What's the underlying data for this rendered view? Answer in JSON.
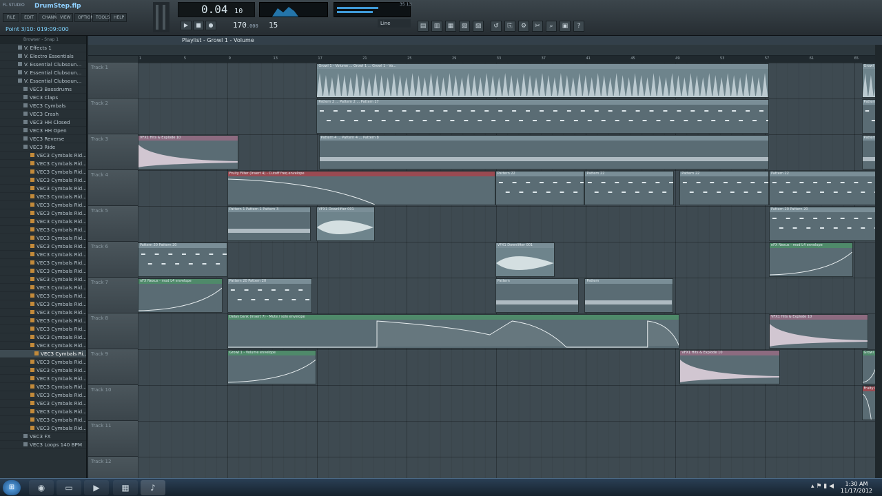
{
  "toolbar": {
    "file": "DrumStep.flp",
    "logo": "FL STUDIO",
    "menu": [
      "FILE",
      "EDIT",
      "CHANNELS",
      "VIEW",
      "OPTIONS",
      "TOOLS",
      "HELP"
    ],
    "hint": "Point 3/10: 019:09:000",
    "time_main": "0.04",
    "time_sub": "10",
    "tempo": "170",
    "tempo_dec": ".000",
    "tempo_label": "TEMPO",
    "pattern": "15",
    "snap": "Line",
    "cpu": "35  13"
  },
  "browser": {
    "header": "Browser - Snap 1",
    "items": [
      {
        "t": "V. Effects 1",
        "k": "f"
      },
      {
        "t": "V. Electro Essentials",
        "k": "f"
      },
      {
        "t": "V. Essential Clubsoun...",
        "k": "f"
      },
      {
        "t": "V. Essential Clubsoun...",
        "k": "f"
      },
      {
        "t": "V. Essential Clubsoun...",
        "k": "f"
      },
      {
        "t": "VEC3 Bassdrums",
        "k": "f"
      },
      {
        "t": "VEC3 Claps",
        "k": "f"
      },
      {
        "t": "VEC3 Cymbals",
        "k": "f"
      },
      {
        "t": "VEC3 Crash",
        "k": "f"
      },
      {
        "t": "VEC3 HH Closed",
        "k": "f"
      },
      {
        "t": "VEC3 HH Open",
        "k": "f"
      },
      {
        "t": "VEC3 Reverse",
        "k": "f"
      },
      {
        "t": "VEC3 Ride",
        "k": "f"
      },
      {
        "t": "VEC3 Cymbals Rid...",
        "k": "s"
      },
      {
        "t": "VEC3 Cymbals Rid...",
        "k": "s"
      },
      {
        "t": "VEC3 Cymbals Rid...",
        "k": "s"
      },
      {
        "t": "VEC3 Cymbals Rid...",
        "k": "s"
      },
      {
        "t": "VEC3 Cymbals Rid...",
        "k": "s"
      },
      {
        "t": "VEC3 Cymbals Rid...",
        "k": "s"
      },
      {
        "t": "VEC3 Cymbals Rid...",
        "k": "s"
      },
      {
        "t": "VEC3 Cymbals Rid...",
        "k": "s"
      },
      {
        "t": "VEC3 Cymbals Rid...",
        "k": "s"
      },
      {
        "t": "VEC3 Cymbals Rid...",
        "k": "s"
      },
      {
        "t": "VEC3 Cymbals Rid...",
        "k": "s"
      },
      {
        "t": "VEC3 Cymbals Rid...",
        "k": "s"
      },
      {
        "t": "VEC3 Cymbals Rid...",
        "k": "s"
      },
      {
        "t": "VEC3 Cymbals Rid...",
        "k": "s"
      },
      {
        "t": "VEC3 Cymbals Rid...",
        "k": "s"
      },
      {
        "t": "VEC3 Cymbals Rid...",
        "k": "s"
      },
      {
        "t": "VEC3 Cymbals Rid...",
        "k": "s"
      },
      {
        "t": "VEC3 Cymbals Rid...",
        "k": "s"
      },
      {
        "t": "VEC3 Cymbals Rid...",
        "k": "s"
      },
      {
        "t": "VEC3 Cymbals Rid...",
        "k": "s"
      },
      {
        "t": "VEC3 Cymbals Rid...",
        "k": "s"
      },
      {
        "t": "VEC3 Cymbals Rid...",
        "k": "s"
      },
      {
        "t": "VEC3 Cymbals Rid...",
        "k": "s"
      },
      {
        "t": "VEC3 Cymbals Rid...",
        "k": "s"
      },
      {
        "t": "VEC3 Cymbals Ri...",
        "k": "s",
        "sel": true
      },
      {
        "t": "VEC3 Cymbals Rid...",
        "k": "s"
      },
      {
        "t": "VEC3 Cymbals Rid...",
        "k": "s"
      },
      {
        "t": "VEC3 Cymbals Rid...",
        "k": "s"
      },
      {
        "t": "VEC3 Cymbals Rid...",
        "k": "s"
      },
      {
        "t": "VEC3 Cymbals Rid...",
        "k": "s"
      },
      {
        "t": "VEC3 Cymbals Rid...",
        "k": "s"
      },
      {
        "t": "VEC3 Cymbals Rid...",
        "k": "s"
      },
      {
        "t": "VEC3 Cymbals Rid...",
        "k": "s"
      },
      {
        "t": "VEC3 Cymbals Rid...",
        "k": "s"
      },
      {
        "t": "VEC3 FX",
        "k": "f"
      },
      {
        "t": "VEC3 Loops 140 BPM",
        "k": "f"
      }
    ]
  },
  "playlist": {
    "title": "Playlist - Growl 1 - Volume",
    "tracks": [
      "Track 1",
      "Track 2",
      "Track 3",
      "Track 4",
      "Track 5",
      "Track 6",
      "Track 7",
      "Track 8",
      "Track 9",
      "Track 10",
      "Track 11",
      "Track 12"
    ],
    "bars": [
      "1",
      "5",
      "9",
      "13",
      "17",
      "21",
      "25",
      "29",
      "33",
      "37",
      "41",
      "45",
      "49",
      "53",
      "57",
      "61",
      "65"
    ],
    "clips": [
      {
        "track": 0,
        "start": 16,
        "len": 40.5,
        "label": "Growl 1 - Volume ... Growl 1 ... Growl 1 - Vo...",
        "kind": "audio",
        "wave": "spikes"
      },
      {
        "track": 0,
        "start": 64.8,
        "len": 1.5,
        "label": "Growl 1",
        "kind": "audio",
        "wave": "spikes"
      },
      {
        "track": 1,
        "start": 16,
        "len": 40.5,
        "label": "Pattern 2 ... Pattern 2 ... Pattern 17",
        "kind": "pattern",
        "wave": "notes"
      },
      {
        "track": 1,
        "start": 64.8,
        "len": 1.5,
        "label": "Pattern",
        "kind": "pattern",
        "wave": "notes"
      },
      {
        "track": 2,
        "start": 0,
        "len": 9,
        "label": "VFX1 Hits & Explode 10",
        "kind": "pink",
        "wave": "decay"
      },
      {
        "track": 2,
        "start": 16.2,
        "len": 40.3,
        "label": "Pattern 4 ... Pattern 4 ... Pattern 8",
        "kind": "pattern",
        "wave": "flat"
      },
      {
        "track": 2,
        "start": 64.8,
        "len": 1.5,
        "label": "Pattern",
        "kind": "pattern",
        "wave": "flat"
      },
      {
        "track": 3,
        "start": 8,
        "len": 24,
        "label": "Fruity Filter (Insert 4) - Cutoff freq envelope",
        "kind": "red",
        "wave": "fall"
      },
      {
        "track": 3,
        "start": 32,
        "len": 8,
        "label": "Pattern 22",
        "kind": "pattern",
        "wave": "notes"
      },
      {
        "track": 3,
        "start": 40,
        "len": 8,
        "label": "Pattern 22",
        "kind": "pattern",
        "wave": "notes"
      },
      {
        "track": 3,
        "start": 48.5,
        "len": 8,
        "label": "Pattern 22",
        "kind": "pattern",
        "wave": "notes"
      },
      {
        "track": 3,
        "start": 56.5,
        "len": 9.8,
        "label": "Pattern 22",
        "kind": "pattern",
        "wave": "notes"
      },
      {
        "track": 4,
        "start": 8,
        "len": 7.5,
        "label": "Pattern 1  Pattern 1  Pattern 3",
        "kind": "pattern",
        "wave": "flat"
      },
      {
        "track": 4,
        "start": 16,
        "len": 5.2,
        "label": "VFX1 Downlifter 001",
        "kind": "audio",
        "wave": "swell"
      },
      {
        "track": 4,
        "start": 56.5,
        "len": 9.8,
        "label": "Pattern 20  Pattern 20",
        "kind": "pattern",
        "wave": "notes"
      },
      {
        "track": 5,
        "start": 0,
        "len": 8,
        "label": "Pattern 20  Pattern 20",
        "kind": "pattern",
        "wave": "notes"
      },
      {
        "track": 5,
        "start": 32,
        "len": 5.3,
        "label": "VFX1 Downlifter 001",
        "kind": "audio",
        "wave": "swell"
      },
      {
        "track": 5,
        "start": 56.5,
        "len": 7.5,
        "label": "nFX Nexus - mod L4 envelope",
        "kind": "green",
        "wave": "rise"
      },
      {
        "track": 6,
        "start": 0,
        "len": 7.6,
        "label": "nFX Nexus - mod L4 envelope",
        "kind": "green",
        "wave": "rise"
      },
      {
        "track": 6,
        "start": 8,
        "len": 7.6,
        "label": "Pattern 20  Pattern 20",
        "kind": "pattern",
        "wave": "notes"
      },
      {
        "track": 6,
        "start": 32,
        "len": 7.5,
        "label": "Pattern",
        "kind": "pattern",
        "wave": "flat"
      },
      {
        "track": 6,
        "start": 40,
        "len": 7.9,
        "label": "Pattern",
        "kind": "pattern",
        "wave": "flat"
      },
      {
        "track": 7,
        "start": 8,
        "len": 40.5,
        "label": "Delay bank (Insert 7) - Mute / solo envelope",
        "kind": "green",
        "wave": "env"
      },
      {
        "track": 7,
        "start": 56.5,
        "len": 8.9,
        "label": "VFX1 Hits & Explode 10",
        "kind": "pink",
        "wave": "decay"
      },
      {
        "track": 8,
        "start": 8,
        "len": 8,
        "label": "Growl 1 - Volume envelope",
        "kind": "green",
        "wave": "rise"
      },
      {
        "track": 8,
        "start": 48.5,
        "len": 9,
        "label": "VFX1 Hits & Explode 10",
        "kind": "pink",
        "wave": "decay"
      },
      {
        "track": 8,
        "start": 64.8,
        "len": 1.5,
        "label": "Growl 1",
        "kind": "green",
        "wave": "rise"
      },
      {
        "track": 9,
        "start": 64.8,
        "len": 1.5,
        "label": "Fruity F",
        "kind": "red",
        "wave": "fall"
      }
    ]
  },
  "taskbar": {
    "time": "1:30 AM",
    "date": "11/17/2012"
  }
}
